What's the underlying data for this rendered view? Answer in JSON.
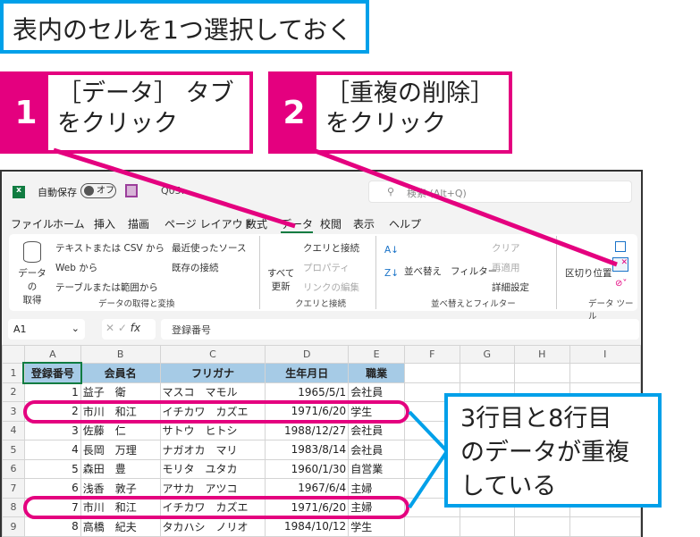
{
  "instruction": "表内のセルを1つ選択しておく",
  "callouts": [
    {
      "num": "1",
      "line1": "［データ］ タブ",
      "line2": "をクリック"
    },
    {
      "num": "2",
      "line1": "［重複の削除］",
      "line2": "をクリック"
    }
  ],
  "note": {
    "line1": "3行目と8行目",
    "line2": "のデータが重複",
    "line3": "している"
  },
  "colors": {
    "accent_magenta": "#e4007f",
    "accent_cyan": "#00a0e9",
    "excel_green": "#107c41",
    "header_fill": "#a6cbe6"
  },
  "titlebar": {
    "autosave": "自動保存",
    "toggle": "オフ",
    "filename": "Q05…",
    "search_placeholder": "検索 (Alt+Q)"
  },
  "tabs": [
    "ファイル",
    "ホーム",
    "挿入",
    "描画",
    "ページ レイアウト",
    "数式",
    "データ",
    "校閲",
    "表示",
    "ヘルプ"
  ],
  "ribbon": {
    "get_data": "データの\n取得",
    "text_csv": "テキストまたは CSV から",
    "web": "Web から",
    "table_range": "テーブルまたは範囲から",
    "recent": "最近使ったソース",
    "existing": "既存の接続",
    "group1": "データの取得と変換",
    "refresh": "すべて\n更新",
    "queries": "クエリと接続",
    "properties": "プロパティ",
    "edit_links": "リンクの編集",
    "group2": "クエリと接続",
    "sort": "並べ替え",
    "filter": "フィルター",
    "clear": "クリア",
    "reapply": "再適用",
    "advanced": "詳細設定",
    "group3": "並べ替えとフィルター",
    "text_to_columns": "区切り位置",
    "group4": "データ ツール"
  },
  "formula_bar": {
    "name_box": "A1",
    "fx": "fx",
    "content": "登録番号"
  },
  "sheet": {
    "columns": [
      "A",
      "B",
      "C",
      "D",
      "E",
      "F",
      "G",
      "H",
      "I"
    ],
    "headers": [
      "登録番号",
      "会員名",
      "フリガナ",
      "生年月日",
      "職業"
    ],
    "rows": [
      [
        "1",
        "益子　衛",
        "マスコ　マモル",
        "1965/5/1",
        "会社員"
      ],
      [
        "2",
        "市川　和江",
        "イチカワ　カズエ",
        "1971/6/20",
        "学生"
      ],
      [
        "3",
        "佐藤　仁",
        "サトウ　ヒトシ",
        "1988/12/27",
        "会社員"
      ],
      [
        "4",
        "長岡　万理",
        "ナガオカ　マリ",
        "1983/8/14",
        "会社員"
      ],
      [
        "5",
        "森田　豊",
        "モリタ　ユタカ",
        "1960/1/30",
        "自営業"
      ],
      [
        "6",
        "浅香　敦子",
        "アサカ　アツコ",
        "1967/6/4",
        "主婦"
      ],
      [
        "7",
        "市川　和江",
        "イチカワ　カズエ",
        "1971/6/20",
        "主婦"
      ],
      [
        "8",
        "高橋　紀夫",
        "タカハシ　ノリオ",
        "1984/10/12",
        "学生"
      ]
    ]
  }
}
